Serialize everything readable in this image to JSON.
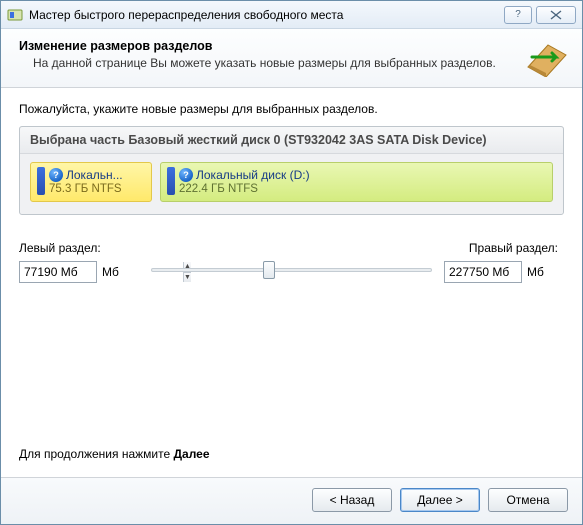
{
  "title": "Мастер быстрого перераспределения свободного места",
  "header": {
    "title": "Изменение размеров разделов",
    "sub": "На данной странице Вы можете указать новые размеры для выбранных разделов."
  },
  "instruction": "Пожалуйста, укажите новые размеры для выбранных разделов.",
  "disk": {
    "header": "Выбрана часть Базовый жесткий диск 0 (ST932042 3AS SATA Disk Device)",
    "parts": [
      {
        "name": "Локальн...",
        "sub": "75.3 ГБ NTFS"
      },
      {
        "name": "Локальный диск (D:)",
        "sub": "222.4 ГБ NTFS"
      }
    ]
  },
  "left": {
    "label": "Левый раздел:",
    "value": "77190 Мб",
    "unit": "Мб"
  },
  "right": {
    "label": "Правый раздел:",
    "value": "227750 Мб",
    "unit": "Мб"
  },
  "continue": {
    "prefix": "Для продолжения нажмите ",
    "action": "Далее"
  },
  "buttons": {
    "back": "< Назад",
    "next": "Далее >",
    "cancel": "Отмена"
  }
}
